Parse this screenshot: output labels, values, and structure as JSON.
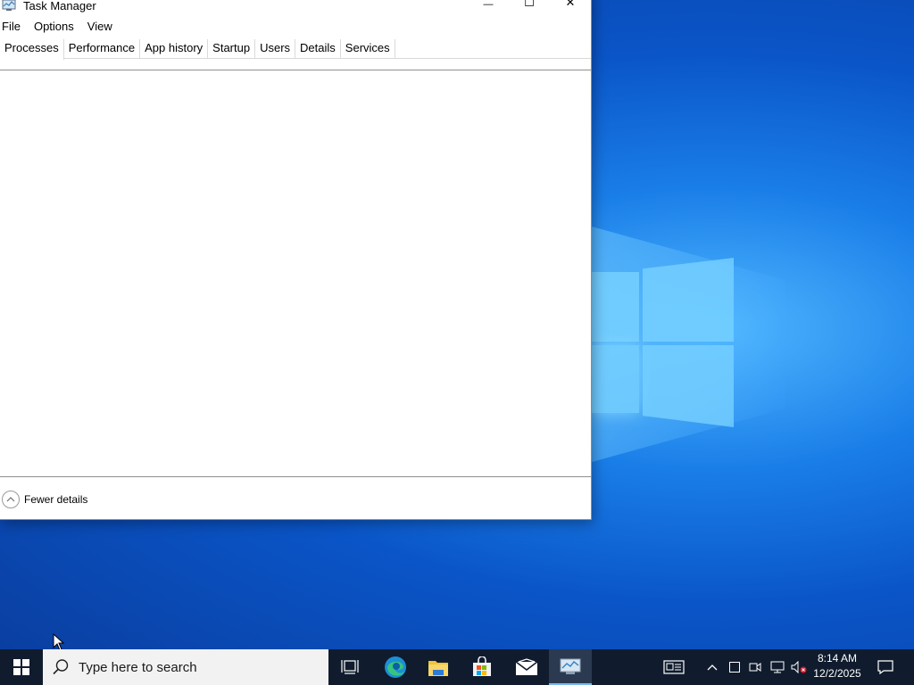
{
  "window": {
    "title": "Task Manager",
    "minimize_glyph": "—",
    "maximize_glyph": "☐",
    "close_glyph": "✕"
  },
  "menu": [
    "File",
    "Options",
    "View"
  ],
  "tabs": [
    {
      "label": "Processes",
      "active": true
    },
    {
      "label": "Performance",
      "active": false
    },
    {
      "label": "App history",
      "active": false
    },
    {
      "label": "Startup",
      "active": false
    },
    {
      "label": "Users",
      "active": false
    },
    {
      "label": "Details",
      "active": false
    },
    {
      "label": "Services",
      "active": false
    }
  ],
  "footer": {
    "fewer_details": "Fewer details"
  },
  "taskbar": {
    "search_placeholder": "Type here to search",
    "pinned": [
      "task-view-icon",
      "edge-icon",
      "file-explorer-icon",
      "microsoft-store-icon",
      "mail-icon",
      "task-manager-icon"
    ],
    "active_app": "task-manager-icon"
  },
  "tray": {
    "time": "8:14 AM",
    "date": "12/2/2025"
  },
  "colors": {
    "taskbar": "#101c2e",
    "active_indicator": "#76b9ed",
    "desktop": "#0a55c8"
  }
}
